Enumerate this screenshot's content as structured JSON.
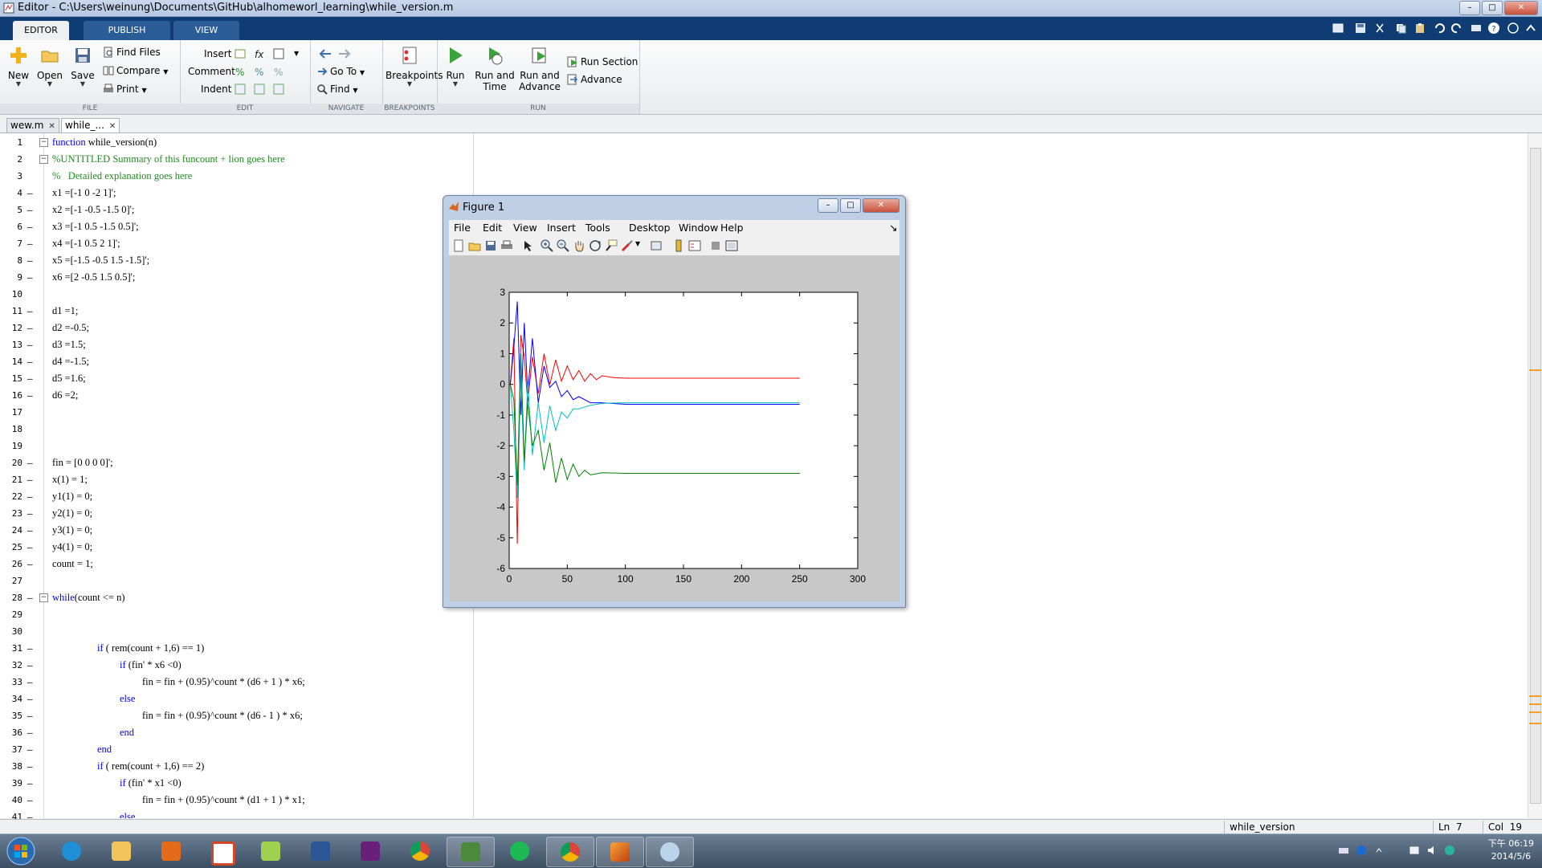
{
  "window": {
    "title": "Editor - C:\\Users\\weinung\\Documents\\GitHub\\alhomeworl_learning\\while_version.m"
  },
  "ribbon_tabs": [
    "EDITOR",
    "PUBLISH",
    "VIEW"
  ],
  "ribbon": {
    "file": {
      "label": "FILE",
      "new": "New",
      "open": "Open",
      "save": "Save",
      "find_files": "Find Files",
      "compare": "Compare",
      "print": "Print"
    },
    "edit": {
      "label": "EDIT",
      "insert": "Insert",
      "comment": "Comment",
      "indent": "Indent"
    },
    "navigate": {
      "label": "NAVIGATE",
      "go_to": "Go To",
      "find": "Find"
    },
    "breakpoints": {
      "label": "BREAKPOINTS",
      "breakpoints": "Breakpoints"
    },
    "run": {
      "label": "RUN",
      "run": "Run",
      "run_and_time_1": "Run and",
      "run_and_time_2": "Time",
      "run_and_advance_1": "Run and",
      "run_and_advance_2": "Advance",
      "run_section": "Run Section",
      "advance": "Advance"
    }
  },
  "doc_tabs": [
    {
      "label": "wew.m"
    },
    {
      "label": "while_..."
    }
  ],
  "code_lines": [
    {
      "n": "1",
      "exec": false,
      "text": "function while_version(n)",
      "kw": "function",
      "rest": " while_version(n)"
    },
    {
      "n": "2",
      "exec": false,
      "text": "%UNTITLED Summary of this funcount + lion goes here",
      "comment": true
    },
    {
      "n": "3",
      "exec": false,
      "text": "%   Detailed explanation goes here",
      "comment": true
    },
    {
      "n": "4",
      "exec": true,
      "text": "x1 =[-1 0 -2 1]';"
    },
    {
      "n": "5",
      "exec": true,
      "text": "x2 =[-1 -0.5 -1.5 0]';"
    },
    {
      "n": "6",
      "exec": true,
      "text": "x3 =[-1 0.5 -1.5 0.5]';"
    },
    {
      "n": "7",
      "exec": true,
      "text": "x4 =[-1 0.5 2 1]';"
    },
    {
      "n": "8",
      "exec": true,
      "text": "x5 =[-1.5 -0.5 1.5 -1.5]';"
    },
    {
      "n": "9",
      "exec": true,
      "text": "x6 =[2 -0.5 1.5 0.5]';"
    },
    {
      "n": "10",
      "exec": false,
      "text": ""
    },
    {
      "n": "11",
      "exec": true,
      "text": "d1 =1;"
    },
    {
      "n": "12",
      "exec": true,
      "text": "d2 =-0.5;"
    },
    {
      "n": "13",
      "exec": true,
      "text": "d3 =1.5;"
    },
    {
      "n": "14",
      "exec": true,
      "text": "d4 =-1.5;"
    },
    {
      "n": "15",
      "exec": true,
      "text": "d5 =1.6;"
    },
    {
      "n": "16",
      "exec": true,
      "text": "d6 =2;"
    },
    {
      "n": "17",
      "exec": false,
      "text": ""
    },
    {
      "n": "18",
      "exec": false,
      "text": ""
    },
    {
      "n": "19",
      "exec": false,
      "text": ""
    },
    {
      "n": "20",
      "exec": true,
      "text": "fin = [0 0 0 0]';"
    },
    {
      "n": "21",
      "exec": true,
      "text": "x(1) = 1;"
    },
    {
      "n": "22",
      "exec": true,
      "text": "y1(1) = 0;"
    },
    {
      "n": "23",
      "exec": true,
      "text": "y2(1) = 0;"
    },
    {
      "n": "24",
      "exec": true,
      "text": "y3(1) = 0;"
    },
    {
      "n": "25",
      "exec": true,
      "text": "y4(1) = 0;"
    },
    {
      "n": "26",
      "exec": true,
      "text": "count = 1;"
    },
    {
      "n": "27",
      "exec": false,
      "text": ""
    },
    {
      "n": "28",
      "exec": true,
      "text": "while(count <= n)",
      "kw": "while",
      "rest": "(count <= n)"
    },
    {
      "n": "29",
      "exec": false,
      "text": ""
    },
    {
      "n": "30",
      "exec": false,
      "text": ""
    },
    {
      "n": "31",
      "exec": true,
      "indent": 2,
      "text": "if ( rem(count + 1,6) == 1)",
      "kw": "if",
      "rest": " ( rem(count + 1,6) == 1)"
    },
    {
      "n": "32",
      "exec": true,
      "indent": 3,
      "text": "if (fin' * x6 <0)",
      "kw": "if",
      "rest": " (fin' * x6 <0)"
    },
    {
      "n": "33",
      "exec": true,
      "indent": 4,
      "text": "fin = fin + (0.95)^count * (d6 + 1 ) * x6;"
    },
    {
      "n": "34",
      "exec": true,
      "indent": 3,
      "text": "else",
      "kw": "else",
      "rest": ""
    },
    {
      "n": "35",
      "exec": true,
      "indent": 4,
      "text": "fin = fin + (0.95)^count * (d6 - 1 ) * x6;"
    },
    {
      "n": "36",
      "exec": true,
      "indent": 3,
      "text": "end",
      "kw": "end",
      "rest": ""
    },
    {
      "n": "37",
      "exec": true,
      "indent": 2,
      "text": "end",
      "kw": "end",
      "rest": ""
    },
    {
      "n": "38",
      "exec": true,
      "indent": 2,
      "text": "if ( rem(count + 1,6) == 2)",
      "kw": "if",
      "rest": " ( rem(count + 1,6) == 2)"
    },
    {
      "n": "39",
      "exec": true,
      "indent": 3,
      "text": "if (fin' * x1 <0)",
      "kw": "if",
      "rest": " (fin' * x1 <0)"
    },
    {
      "n": "40",
      "exec": true,
      "indent": 4,
      "text": "fin = fin + (0.95)^count * (d1 + 1 ) * x1;"
    },
    {
      "n": "41",
      "exec": true,
      "indent": 3,
      "text": "else",
      "kw": "else",
      "rest": ""
    }
  ],
  "status": {
    "function_name": "while_version",
    "ln_label": "Ln",
    "ln_value": "7",
    "col_label": "Col",
    "col_value": "19"
  },
  "figure": {
    "title": "Figure 1",
    "menu": [
      "File",
      "Edit",
      "View",
      "Insert",
      "Tools",
      "Desktop",
      "Window",
      "Help"
    ]
  },
  "chart_data": {
    "type": "line",
    "xlim": [
      0,
      300
    ],
    "ylim": [
      -6,
      3
    ],
    "xticks": [
      0,
      50,
      100,
      150,
      200,
      250,
      300
    ],
    "yticks": [
      3,
      2,
      1,
      0,
      -1,
      -2,
      -3,
      -4,
      -5,
      -6
    ],
    "grid": false,
    "series": [
      {
        "color": "#ff0000",
        "x": [
          1,
          4,
          7,
          10,
          13,
          16,
          20,
          25,
          30,
          35,
          40,
          45,
          50,
          55,
          60,
          65,
          70,
          75,
          80,
          90,
          100,
          120,
          150,
          200,
          250
        ],
        "values": [
          0,
          1.5,
          -5.2,
          1.6,
          0.9,
          -0.6,
          0.9,
          -0.3,
          1.0,
          0.0,
          0.8,
          0.1,
          0.6,
          0.15,
          0.45,
          0.1,
          0.35,
          0.15,
          0.28,
          0.22,
          0.2,
          0.2,
          0.2,
          0.2,
          0.2
        ]
      },
      {
        "color": "#0000ff",
        "x": [
          1,
          4,
          7,
          10,
          13,
          16,
          20,
          25,
          30,
          35,
          40,
          45,
          50,
          55,
          60,
          70,
          80,
          100,
          150,
          200,
          250
        ],
        "values": [
          0,
          1.2,
          2.7,
          -1.0,
          2.0,
          -0.3,
          1.5,
          -0.6,
          0.6,
          -0.1,
          0.1,
          -0.4,
          -0.2,
          -0.5,
          -0.4,
          -0.6,
          -0.6,
          -0.65,
          -0.65,
          -0.65,
          -0.65
        ]
      },
      {
        "color": "#00bfbf",
        "x": [
          1,
          4,
          7,
          10,
          13,
          16,
          20,
          25,
          30,
          35,
          40,
          45,
          50,
          55,
          60,
          70,
          80,
          100,
          150,
          200,
          250
        ],
        "values": [
          0,
          -1.5,
          -3.7,
          0.3,
          -2.8,
          0.1,
          -2.3,
          -0.6,
          -1.9,
          -0.7,
          -1.5,
          -0.9,
          -1.1,
          -0.8,
          -0.8,
          -0.68,
          -0.62,
          -0.6,
          -0.6,
          -0.6,
          -0.6
        ]
      },
      {
        "color": "#008000",
        "x": [
          1,
          4,
          7,
          10,
          13,
          16,
          20,
          25,
          30,
          35,
          40,
          45,
          50,
          55,
          60,
          65,
          70,
          80,
          100,
          150,
          200,
          250
        ],
        "values": [
          0,
          -0.5,
          -3.3,
          1.0,
          -2.5,
          -0.6,
          -2.0,
          -1.5,
          -2.8,
          -1.9,
          -3.2,
          -2.4,
          -3.1,
          -2.6,
          -3.0,
          -2.8,
          -2.95,
          -2.88,
          -2.9,
          -2.9,
          -2.9,
          -2.9
        ]
      }
    ]
  },
  "taskbar": {
    "clock_time": "下午 06:19",
    "clock_date": "2014/5/6"
  }
}
